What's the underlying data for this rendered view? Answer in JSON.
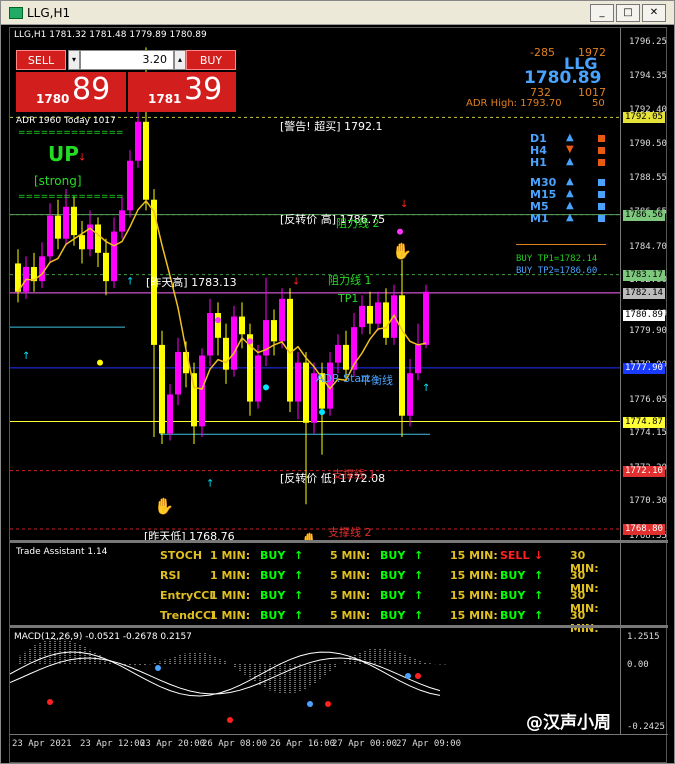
{
  "window": {
    "title": "LLG,H1",
    "btn_min": "_",
    "btn_max": "□",
    "btn_close": "✕"
  },
  "chart": {
    "header": "LLG,H1  1781.32 1781.48 1779.89 1780.89",
    "price_labels": [
      "1796.25",
      "1794.35",
      "1792.40",
      "1790.50",
      "1788.55",
      "1786.65",
      "1784.70",
      "1782.80",
      "1780.89",
      "1779.90",
      "1778.00",
      "1776.05",
      "1774.15",
      "1772.20",
      "1770.30",
      "1768.35"
    ],
    "tags": [
      {
        "text": "1792.05",
        "bg": "#e5e23a"
      },
      {
        "text": "1786.56",
        "bg": "#7ec87e"
      },
      {
        "text": "1783.17",
        "bg": "#7ec87e"
      },
      {
        "text": "1782.14",
        "bg": "#bbbbbb"
      },
      {
        "text": "1780.89",
        "bg": "#ffffff"
      },
      {
        "text": "1777.90",
        "bg": "#1a3aff"
      },
      {
        "text": "1774.87",
        "bg": "#ffff33"
      },
      {
        "text": "1772.10",
        "bg": "#e03030"
      },
      {
        "text": "1768.80",
        "bg": "#e03030"
      }
    ],
    "time_labels": [
      "23 Apr 2021",
      "23 Apr 12:00",
      "23 Apr 20:00",
      "26 Apr 08:00",
      "26 Apr 16:00",
      "27 Apr 00:00",
      "27 Apr 09:00"
    ],
    "annotations": {
      "warning": "[警告! 超买] 1792.1",
      "reversal_high": "[反转价 高] 1786.75",
      "resist2": "阻力线 2",
      "yesterday_high": "[昨天高] 1783.13",
      "resist1": "阻力线 1",
      "tp1": "TP1",
      "adr_start": "ADR Start",
      "pivot": "平衡线",
      "reversal_low": "[反转价 低] 1772.08",
      "support1": "支撑线 1",
      "yesterday_low": "[昨天低] 1768.76",
      "support2": "支撑线 2"
    },
    "adr": {
      "left": "ADR 1960  Today 1017",
      "up": "UP",
      "strong": "[strong]",
      "dashes": "=============="
    },
    "stats": {
      "n1": "-285",
      "n2": "1972",
      "price": "1780.89",
      "symbol": "LLG",
      "n3": "732",
      "n4": "1017",
      "adr_high": "ADR High: 1793.70",
      "n5": "50"
    },
    "timeframes": [
      {
        "name": "D1",
        "trend": "up",
        "box": "#e85a12"
      },
      {
        "name": "H4",
        "trend": "down",
        "box": "#e85a12"
      },
      {
        "name": "H1",
        "trend": "up",
        "box": "#e85a12"
      },
      {
        "name": "M30",
        "trend": "up",
        "box": "#4aa3ff"
      },
      {
        "name": "M15",
        "trend": "up",
        "box": "#4aa3ff"
      },
      {
        "name": "M5",
        "trend": "up",
        "box": "#4aa3ff"
      },
      {
        "name": "M1",
        "trend": "up",
        "box": "#4aa3ff"
      }
    ],
    "buy_tp1": "BUY TP1=1782.14",
    "buy_tp2": "BUY TP2=1786.60"
  },
  "trade_panel": {
    "sell_label": "SELL",
    "buy_label": "BUY",
    "lot": "3.20",
    "sell_big": "89",
    "sell_small": "1780",
    "buy_big": "39",
    "buy_small": "1781"
  },
  "trade_assistant": {
    "title": "Trade Assistant 1.14",
    "rows": [
      {
        "name": "STOCH",
        "cells": [
          {
            "tf": "1 MIN:",
            "sig": "BUY",
            "dir": "up"
          },
          {
            "tf": "5 MIN:",
            "sig": "BUY",
            "dir": "up"
          },
          {
            "tf": "15 MIN:",
            "sig": "SELL",
            "dir": "down"
          },
          {
            "tf": "30 MIN:",
            "sig": "",
            "dir": ""
          }
        ]
      },
      {
        "name": "RSI",
        "cells": [
          {
            "tf": "1 MIN:",
            "sig": "BUY",
            "dir": "up"
          },
          {
            "tf": "5 MIN:",
            "sig": "BUY",
            "dir": "up"
          },
          {
            "tf": "15 MIN:",
            "sig": "BUY",
            "dir": "up"
          },
          {
            "tf": "30 MIN:",
            "sig": "",
            "dir": ""
          }
        ]
      },
      {
        "name": "EntryCCI",
        "cells": [
          {
            "tf": "1 MIN:",
            "sig": "BUY",
            "dir": "up"
          },
          {
            "tf": "5 MIN:",
            "sig": "BUY",
            "dir": "up"
          },
          {
            "tf": "15 MIN:",
            "sig": "BUY",
            "dir": "up"
          },
          {
            "tf": "30 MIN:",
            "sig": "",
            "dir": ""
          }
        ]
      },
      {
        "name": "TrendCCI",
        "cells": [
          {
            "tf": "1 MIN:",
            "sig": "BUY",
            "dir": "up"
          },
          {
            "tf": "5 MIN:",
            "sig": "BUY",
            "dir": "up"
          },
          {
            "tf": "15 MIN:",
            "sig": "BUY",
            "dir": "up"
          },
          {
            "tf": "30 MIN:",
            "sig": "",
            "dir": ""
          }
        ]
      }
    ]
  },
  "macd": {
    "header": "MACD(12,26,9) -0.0521 -0.2678 0.2157",
    "labels": [
      "1.2515",
      "0.00",
      "-0.2425"
    ]
  },
  "watermark": "@汉声小周",
  "colors": {
    "bull": "#ff00ff",
    "bear": "#ffff00",
    "ma": "#f0c020",
    "buy": "#00ff00",
    "sell": "#ff2020"
  }
}
